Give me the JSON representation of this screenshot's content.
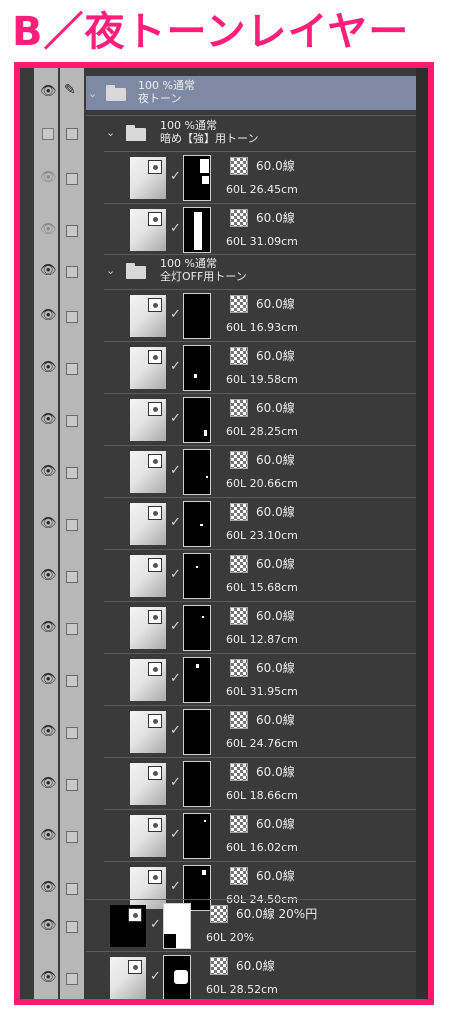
{
  "title": "B／夜トーンレイヤー",
  "group_root": {
    "line1": "100 %通常",
    "line2": "夜トーン"
  },
  "group_dark": {
    "line1": "100 %通常",
    "line2": "暗め【強】用トーン"
  },
  "group_lights": {
    "line1": "100 %通常",
    "line2": "全灯OFF用トーン"
  },
  "layers_dark": [
    {
      "tone": "60.0線",
      "meta": "60L 26.45cm"
    },
    {
      "tone": "60.0線",
      "meta": "60L 31.09cm"
    }
  ],
  "layers_lights": [
    {
      "tone": "60.0線",
      "meta": "60L 16.93cm"
    },
    {
      "tone": "60.0線",
      "meta": "60L 19.58cm"
    },
    {
      "tone": "60.0線",
      "meta": "60L 28.25cm"
    },
    {
      "tone": "60.0線",
      "meta": "60L 20.66cm"
    },
    {
      "tone": "60.0線",
      "meta": "60L 23.10cm"
    },
    {
      "tone": "60.0線",
      "meta": "60L 15.68cm"
    },
    {
      "tone": "60.0線",
      "meta": "60L 12.87cm"
    },
    {
      "tone": "60.0線",
      "meta": "60L 31.95cm"
    },
    {
      "tone": "60.0線",
      "meta": "60L 24.76cm"
    },
    {
      "tone": "60.0線",
      "meta": "60L 18.66cm"
    },
    {
      "tone": "60.0線",
      "meta": "60L 16.02cm"
    },
    {
      "tone": "60.0線",
      "meta": "60L 24.50cm"
    }
  ],
  "layers_root": [
    {
      "tone": "60.0線 20%円",
      "meta": "60L 20%"
    },
    {
      "tone": "60.0線",
      "meta": "60L 28.52cm"
    }
  ],
  "colors": {
    "accent": "#ff1a6e",
    "panel": "#3a3a3a",
    "selected": "#7e8aa4"
  },
  "icons": [
    "eye-icon",
    "pen-icon",
    "folder-icon",
    "chevron-down-icon",
    "checker-tone-icon",
    "layer-mask-thumbnail"
  ]
}
